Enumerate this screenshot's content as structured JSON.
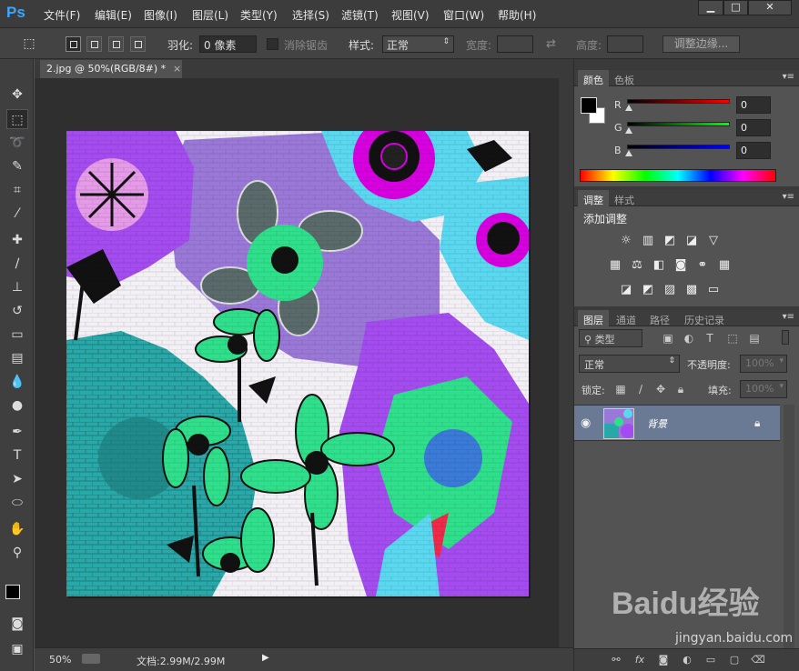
{
  "app": {
    "logo": "Ps"
  },
  "menu": [
    "文件(F)",
    "编辑(E)",
    "图像(I)",
    "图层(L)",
    "类型(Y)",
    "选择(S)",
    "滤镜(T)",
    "视图(V)",
    "窗口(W)",
    "帮助(H)"
  ],
  "window_controls": {
    "minimize": "▁",
    "maximize": "□",
    "close": "✕"
  },
  "options": {
    "feather_label": "羽化:",
    "feather_value": "0 像素",
    "antialias_label": "消除锯齿",
    "style_label": "样式:",
    "style_value": "正常",
    "width_label": "宽度:",
    "height_label": "高度:",
    "refine_edge_button": "调整边缘..."
  },
  "document": {
    "tab_title": "2.jpg @ 50%(RGB/8#) *",
    "tab_close": "×"
  },
  "status": {
    "zoom": "50%",
    "doc_size": "文档:2.99M/2.99M",
    "arrow": "▶"
  },
  "color_panel": {
    "tabs": [
      "颜色",
      "色板"
    ],
    "channels": [
      {
        "label": "R",
        "value": "0",
        "color": "#ff0000"
      },
      {
        "label": "G",
        "value": "0",
        "color": "#00ff00"
      },
      {
        "label": "B",
        "value": "0",
        "color": "#0000ff"
      }
    ]
  },
  "adjust_panel": {
    "tabs": [
      "调整",
      "样式"
    ],
    "title": "添加调整"
  },
  "layers_panel": {
    "tabs": [
      "图层",
      "通道",
      "路径",
      "历史记录"
    ],
    "filter_kind": "类型",
    "blend_mode": "正常",
    "opacity_label": "不透明度:",
    "opacity_value": "100%",
    "lock_label": "锁定:",
    "fill_label": "填充:",
    "fill_value": "100%",
    "layer_name": "背景"
  },
  "watermark": {
    "main": "Baidu经验",
    "sub": "jingyan.baidu.com"
  },
  "colors": {
    "purple": "#a44cf0",
    "lavender": "#9a78d8",
    "teal": "#28a8a8",
    "green": "#2ee08c",
    "cyan": "#5ad8f0",
    "magenta": "#d800e0",
    "red": "#f02a4a"
  }
}
